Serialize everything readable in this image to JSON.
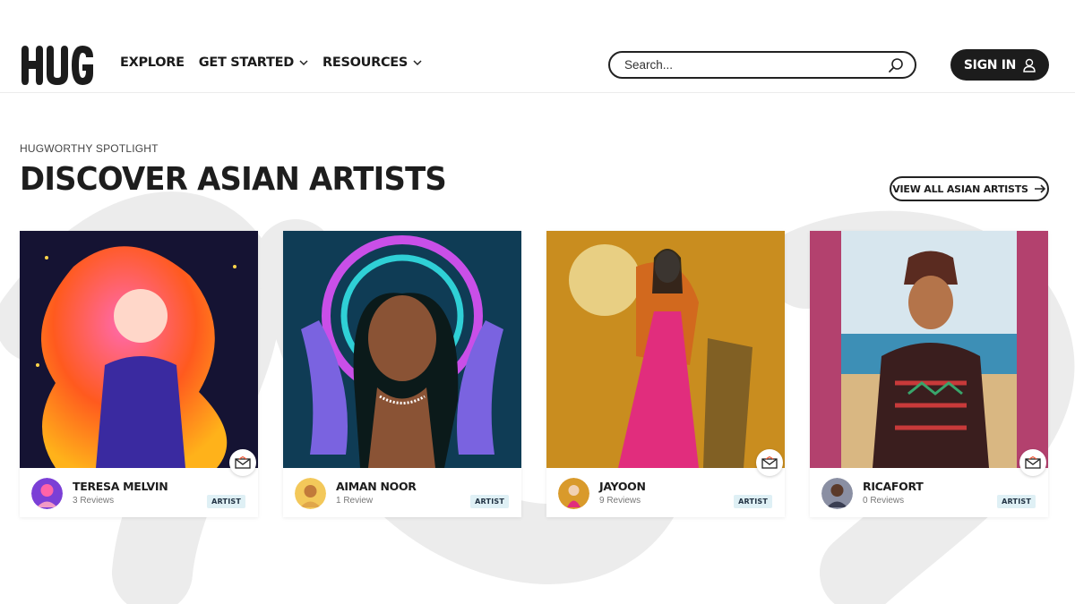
{
  "header": {
    "logo_text": "HUG",
    "nav": [
      {
        "label": "EXPLORE",
        "has_dropdown": false
      },
      {
        "label": "GET STARTED",
        "has_dropdown": true
      },
      {
        "label": "RESOURCES",
        "has_dropdown": true
      }
    ],
    "search": {
      "placeholder": "Search...",
      "icon": "search-icon"
    },
    "signin": {
      "label": "SIGN IN",
      "icon": "user-icon"
    }
  },
  "section": {
    "eyebrow": "HUGWORTHY SPOTLIGHT",
    "title": "DISCOVER ASIAN ARTISTS",
    "view_all_label": "VIEW ALL ASIAN ARTISTS",
    "view_all_icon": "arrow-right-icon"
  },
  "cards": [
    {
      "name": "TERESA MELVIN",
      "reviews": "3 Reviews",
      "badge": "ARTIST",
      "accent": "#ff3d7f"
    },
    {
      "name": "AIMAN NOOR",
      "reviews": "1 Review",
      "badge": "ARTIST",
      "accent": "#8a3fd1"
    },
    {
      "name": "JAYOON",
      "reviews": "9 Reviews",
      "badge": "ARTIST",
      "accent": "#e8246f"
    },
    {
      "name": "RICAFORT",
      "reviews": "0 Reviews",
      "badge": "ARTIST",
      "accent": "#b3416e"
    }
  ],
  "colors": {
    "primary_dark": "#1c1c1c",
    "badge_bg": "#dff0f5",
    "background_deco": "#ededed"
  }
}
